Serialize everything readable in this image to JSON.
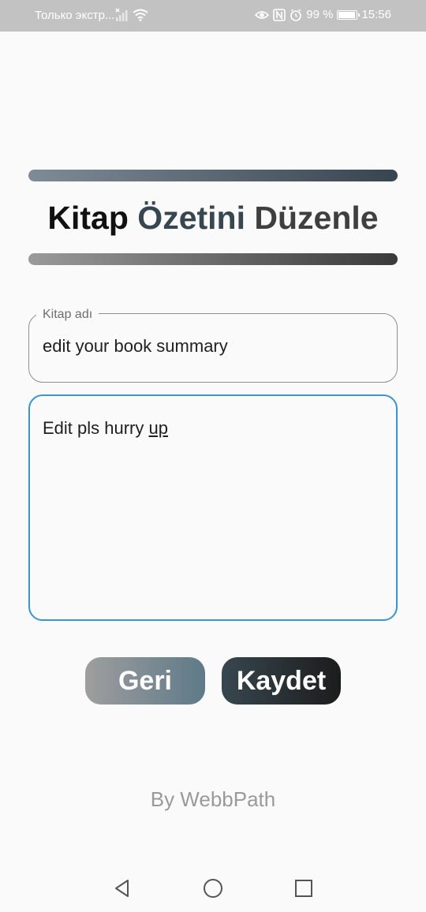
{
  "status_bar": {
    "carrier": "Только экстр...",
    "battery_percent": "99 %",
    "time": "15:56",
    "icons": [
      "signal-x-icon",
      "wifi-icon",
      "eye-icon",
      "nfc-icon",
      "alarm-icon",
      "battery-icon"
    ]
  },
  "header": {
    "title_part1": "Kitap",
    "title_part2": "Özetini",
    "title_part3": "Düzenle"
  },
  "form": {
    "book_name_label": "Kitap adı",
    "book_name_value": "edit your book summary",
    "summary_value_main": "Edit pls hurry ",
    "summary_value_underlined": "up"
  },
  "buttons": {
    "back_label": "Geri",
    "save_label": "Kaydet"
  },
  "footer": {
    "credit": "By WebbPath"
  },
  "navbar": {
    "icons": [
      "back-triangle-icon",
      "home-circle-icon",
      "recents-square-icon"
    ]
  },
  "colors": {
    "accent_blue": "#3596d8",
    "slate": "#37474f",
    "background": "#fafafa"
  }
}
